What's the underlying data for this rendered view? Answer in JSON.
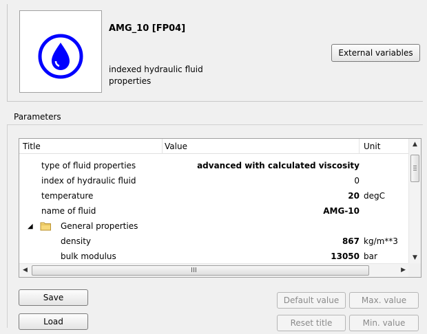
{
  "component": {
    "title": "AMG_10 [FP04]",
    "description": "indexed hydraulic fluid properties",
    "icon": "hydraulic-fluid-drop-icon",
    "icon_color": "#0000ff"
  },
  "buttons": {
    "external_variables": "External variables",
    "save": "Save",
    "load": "Load",
    "default_value": "Default value",
    "max_value": "Max. value",
    "reset_title": "Reset title",
    "min_value": "Min. value"
  },
  "parameters": {
    "group_label": "Parameters",
    "columns": {
      "title": "Title",
      "value": "Value",
      "unit": "Unit"
    },
    "rows": [
      {
        "title": "type of fluid properties",
        "value": "advanced with calculated viscosity",
        "unit": "",
        "bold": true
      },
      {
        "title": "index of hydraulic fluid",
        "value": "0",
        "unit": "",
        "bold": false
      },
      {
        "title": "temperature",
        "value": "20",
        "unit": "degC",
        "bold": true
      },
      {
        "title": "name of fluid",
        "value": "AMG-10",
        "unit": "",
        "bold": true
      },
      {
        "title": "General properties",
        "value": "",
        "unit": "",
        "group": true
      },
      {
        "title": "density",
        "value": "867",
        "unit": "kg/m**3",
        "bold": true
      },
      {
        "title": "bulk modulus",
        "value": "13050",
        "unit": "bar",
        "bold": true
      }
    ],
    "scrollbar_grip": "III"
  }
}
